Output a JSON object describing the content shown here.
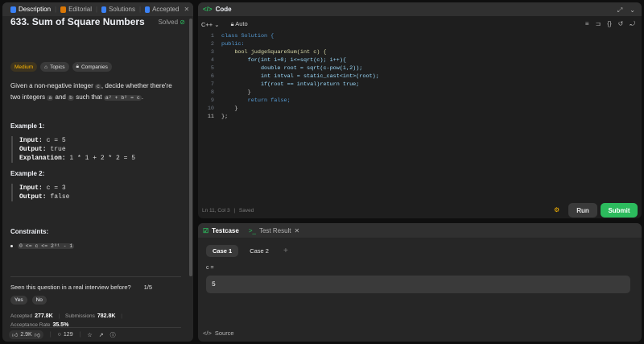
{
  "left": {
    "tabs": [
      {
        "label": "Description",
        "icon": "description-icon"
      },
      {
        "label": "Editorial",
        "icon": "editorial-icon"
      },
      {
        "label": "Solutions",
        "icon": "solutions-icon"
      },
      {
        "label": "Accepted",
        "icon": "accepted-icon"
      }
    ],
    "title": "633. Sum of Square Numbers",
    "solved": "Solved",
    "chips": {
      "difficulty": "Medium",
      "topics": "Topics",
      "companies": "Companies"
    },
    "desc": {
      "p1": "Given a non-negative integer ",
      "c": "c",
      "p2": ", decide whether there're two integers ",
      "a": "a",
      "p3": " and ",
      "b": "b",
      "p4": " such that ",
      "eq": "a² + b² = c",
      "p5": "."
    },
    "example1": {
      "heading": "Example 1:",
      "input_label": "Input:",
      "input": "c = 5",
      "output_label": "Output:",
      "output": "true",
      "explanation_label": "Explanation:",
      "explanation": "1 * 1 + 2 * 2 = 5"
    },
    "example2": {
      "heading": "Example 2:",
      "input_label": "Input:",
      "input": "c = 3",
      "output_label": "Output:",
      "output": "false"
    },
    "constraints_heading": "Constraints:",
    "constraint": "0 <= c <= 2³¹ - 1",
    "interview_q": "Seen this question in a real interview before?",
    "interview_count": "1/5",
    "yes": "Yes",
    "no": "No",
    "accepted_label": "Accepted",
    "accepted_value": "277.8K",
    "submissions_label": "Submissions",
    "submissions_value": "782.8K",
    "rate_label": "Acceptance Rate",
    "rate_value": "35.5%",
    "likes": "2.9K",
    "comments": "129"
  },
  "code": {
    "tab": "Code",
    "language": "C++",
    "mode": "Auto",
    "lines": [
      "class Solution {",
      "public:",
      "    bool judgeSquareSum(int c) {",
      "        for(int i=0; i<=sqrt(c); i++){",
      "            double root = sqrt(c-pow(i,2));",
      "            int intval = static_cast<int>(root);",
      "            if(root == intval)return true;",
      "        }",
      "        return false;",
      "    }",
      "};"
    ],
    "status": "Ln 11, Col 3",
    "saved": "Saved",
    "run": "Run",
    "submit": "Submit"
  },
  "test": {
    "tab_testcase": "Testcase",
    "tab_result": "Test Result",
    "cases": [
      "Case 1",
      "Case 2"
    ],
    "var_label": "c =",
    "var_value": "5",
    "source": "Source"
  },
  "colors": {
    "accent_green": "#2cbb5d",
    "medium": "#ffb800",
    "blue_icon": "#3b82f6"
  }
}
